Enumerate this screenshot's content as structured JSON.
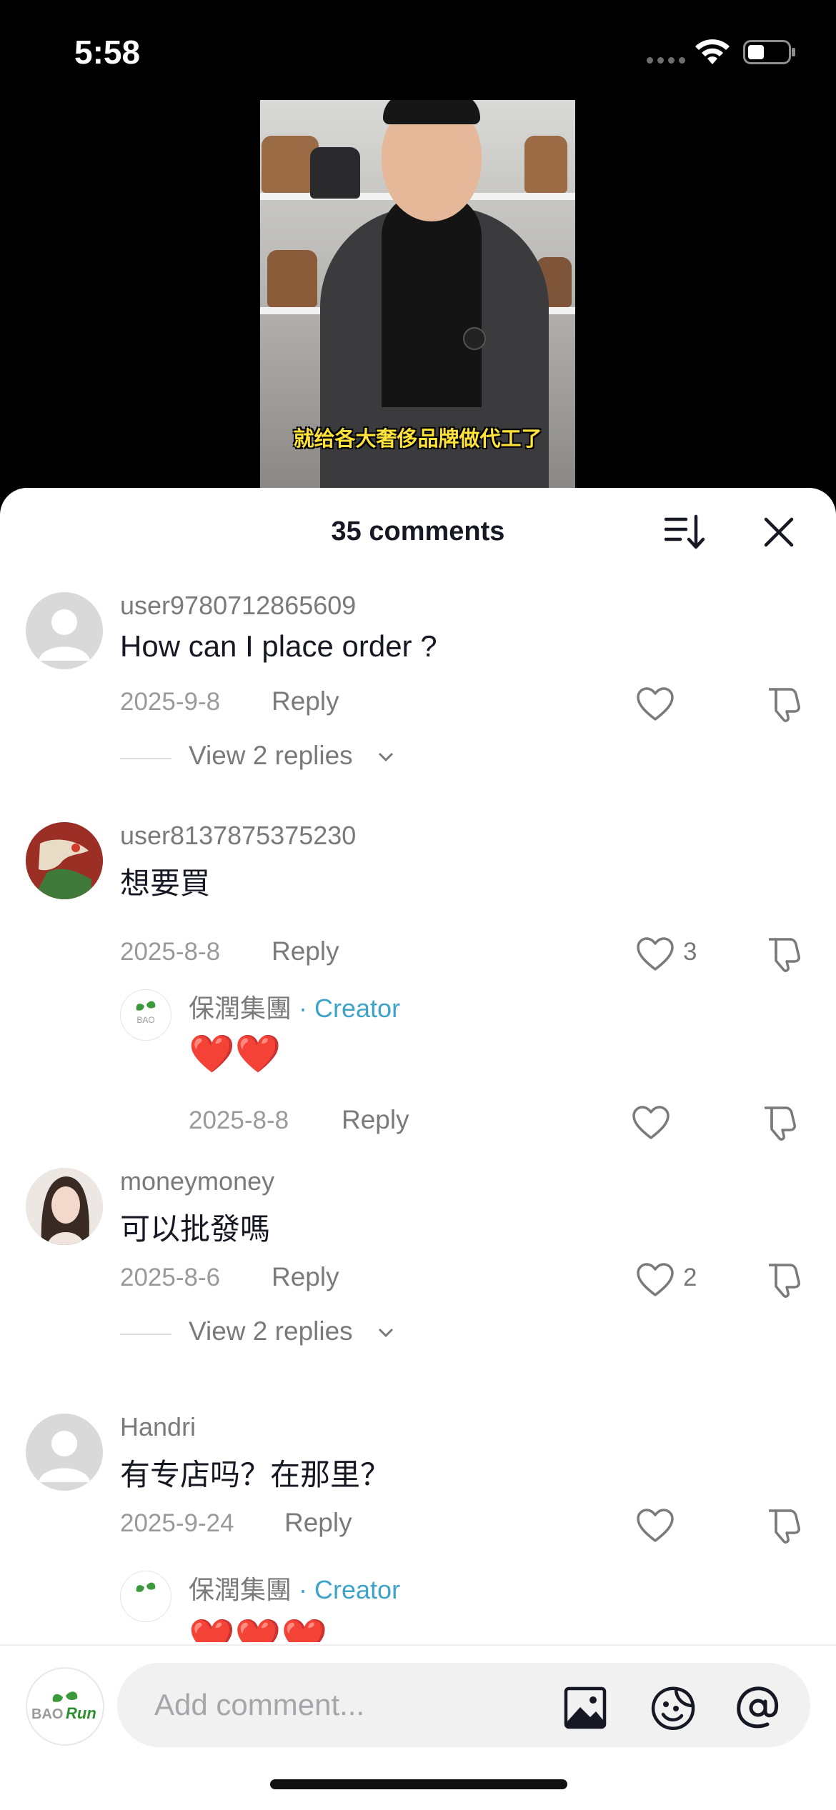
{
  "status_bar": {
    "time": "5:58"
  },
  "video": {
    "subtitle": "就给各大奢侈品牌做代工了"
  },
  "sheet": {
    "title": "35 comments"
  },
  "comments": [
    {
      "username": "user9780712865609",
      "text": "How can I place order ?",
      "date": "2025-9-8",
      "reply_label": "Reply",
      "likes": "",
      "view_replies": "View 2 replies"
    },
    {
      "username": "user8137875375230",
      "text": "想要買",
      "date": "2025-8-8",
      "reply_label": "Reply",
      "likes": "3"
    },
    {
      "username": "moneymoney",
      "text": "可以批發嗎",
      "date": "2025-8-6",
      "reply_label": "Reply",
      "likes": "2",
      "view_replies": "View 2 replies"
    },
    {
      "username": "Handri",
      "text": "有专店吗？在那里？",
      "date": "2025-9-24",
      "reply_label": "Reply",
      "likes": ""
    }
  ],
  "creator_replies": [
    {
      "username": "保潤集團",
      "badge": "· Creator",
      "text": "❤️❤️",
      "date": "2025-8-8",
      "reply_label": "Reply"
    },
    {
      "username": "保潤集團",
      "badge": "· Creator",
      "text": "❤️❤️❤️"
    }
  ],
  "brand": {
    "logo_text_1": "BAO",
    "logo_text_2": "Run"
  },
  "composer": {
    "placeholder": "Add comment..."
  },
  "icons": [
    "wifi-icon",
    "battery-icon",
    "sort-icon",
    "close-icon",
    "heart-icon",
    "dislike-icon",
    "chevron-down-icon",
    "image-icon",
    "emoji-icon",
    "mention-icon"
  ],
  "colors": {
    "creator_accent": "#3ea3c8",
    "subtitle_yellow": "#ffe23a"
  }
}
